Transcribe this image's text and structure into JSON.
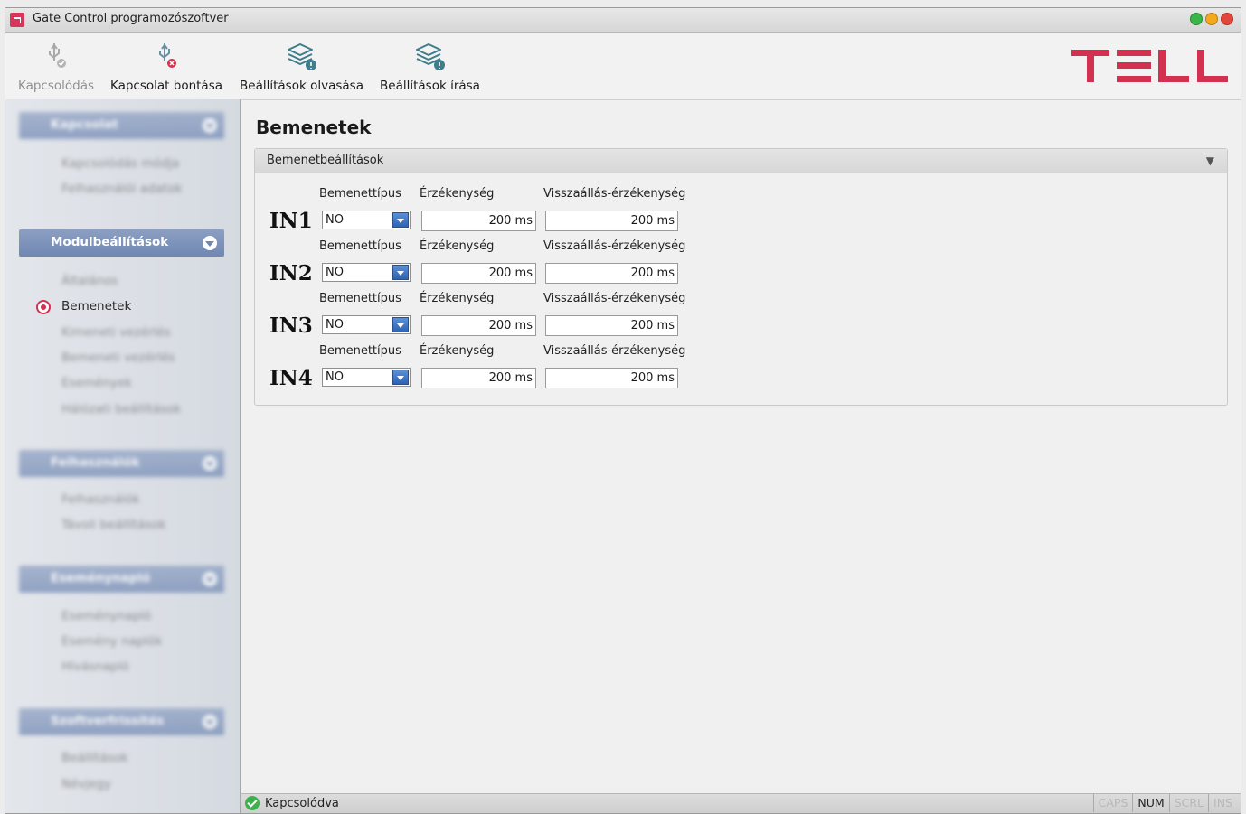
{
  "window": {
    "title": "Gate Control programozószoftver",
    "controls": [
      {
        "name": "minimize",
        "color": "#39b54a"
      },
      {
        "name": "maximize",
        "color": "#f2a91e"
      },
      {
        "name": "close",
        "color": "#e2453c"
      }
    ]
  },
  "toolbar": {
    "connect_label": "Kapcsolódás",
    "disconnect_label": "Kapcsolat bontása",
    "read_label": "Beállítások olvasása",
    "write_label": "Beállítások írása",
    "logo_text": "TELL"
  },
  "sidebar": {
    "sections": [
      {
        "label": "Kapcsolat",
        "blurred": true,
        "items": [
          "Kapcsolódás módja",
          "Felhasználói adatok"
        ]
      },
      {
        "label": "Modulbeállítások",
        "blurred": false,
        "items": [
          "Általános",
          "Bemenetek",
          "Kimeneti vezérlés",
          "Bemeneti vezérlés",
          "Események",
          "Hálózati beállítások"
        ],
        "selected": "Bemenetek"
      },
      {
        "label": "Felhasználók",
        "blurred": true,
        "items": [
          "Felhasználók",
          "Távoli beállítások"
        ]
      },
      {
        "label": "Eseménynapló",
        "blurred": true,
        "items": [
          "Eseménynapló",
          "Esemény naplók",
          "Hívásnapló"
        ]
      },
      {
        "label": "Szoftverfrissítés",
        "blurred": true,
        "items": [
          "Beállítások",
          "Névjegy"
        ]
      }
    ]
  },
  "main": {
    "page_title": "Bemenetek",
    "panel_title": "Bemenetbeállítások",
    "col_type": "Bemenettípus",
    "col_sensitivity": "Érzékenység",
    "col_restore": "Visszaállás-érzékenység",
    "rows": [
      {
        "name": "IN1",
        "type": "NO",
        "sensitivity": "200 ms",
        "restore": "200 ms"
      },
      {
        "name": "IN2",
        "type": "NO",
        "sensitivity": "200 ms",
        "restore": "200 ms"
      },
      {
        "name": "IN3",
        "type": "NO",
        "sensitivity": "200 ms",
        "restore": "200 ms"
      },
      {
        "name": "IN4",
        "type": "NO",
        "sensitivity": "200 ms",
        "restore": "200 ms"
      }
    ]
  },
  "status": {
    "text": "Kapcsolódva",
    "keys": [
      {
        "label": "CAPS",
        "active": false
      },
      {
        "label": "NUM",
        "active": true
      },
      {
        "label": "SCRL",
        "active": false
      },
      {
        "label": "INS",
        "active": false
      }
    ]
  },
  "colors": {
    "accent": "#d2314f",
    "category_bg": "#7a90bb"
  }
}
